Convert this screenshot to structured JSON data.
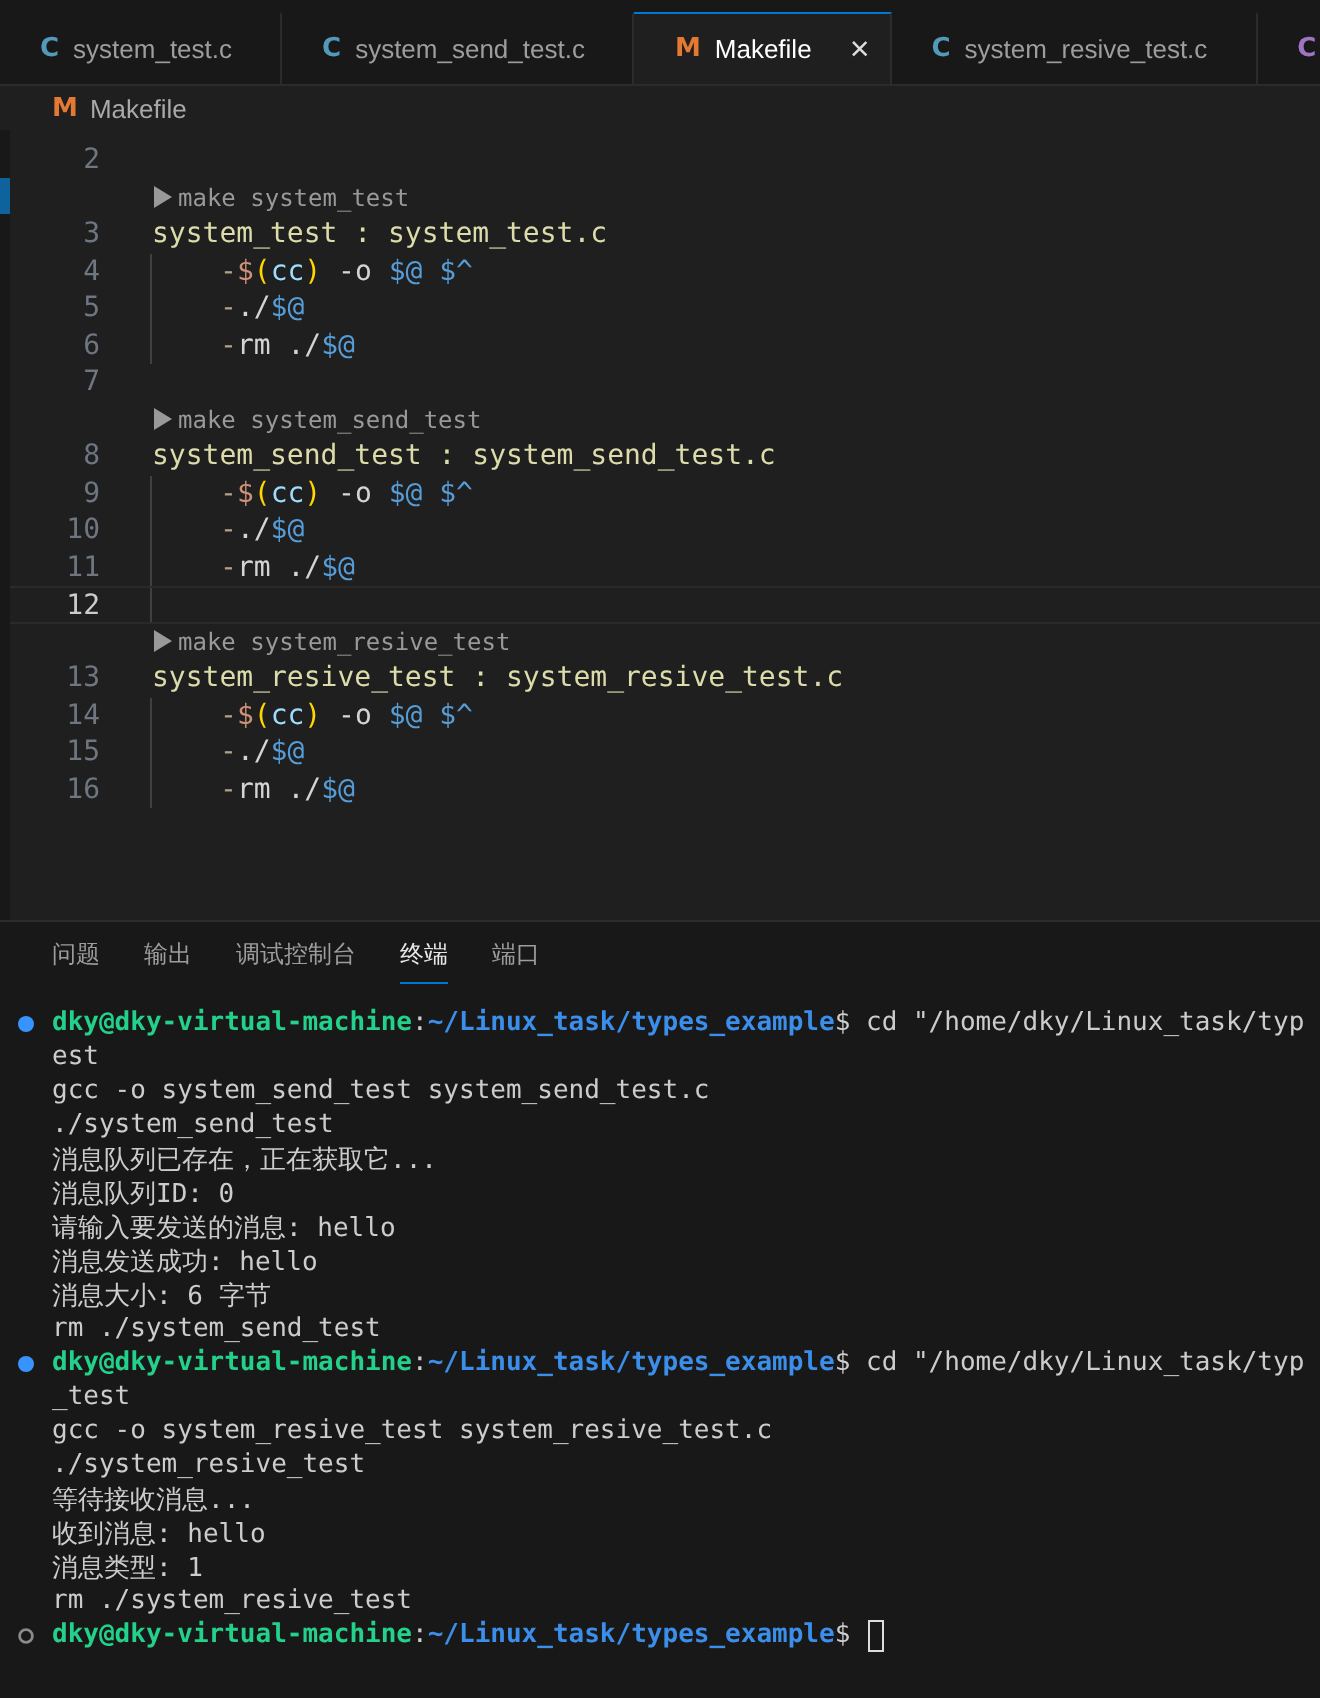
{
  "tabs": [
    {
      "icon": "C",
      "kind": "c",
      "label": "system_test.c",
      "selected": false
    },
    {
      "icon": "C",
      "kind": "c",
      "label": "system_send_test.c",
      "selected": false
    },
    {
      "icon": "M",
      "kind": "makefile",
      "label": "Makefile",
      "selected": true,
      "close": "×"
    },
    {
      "icon": "C",
      "kind": "c",
      "label": "system_resive_test.c",
      "selected": false
    },
    {
      "icon": "C",
      "kind": "other",
      "selected": false
    }
  ],
  "breadcrumb": {
    "icon": "M",
    "kind": "makefile",
    "label": "Makefile"
  },
  "editor_lines": [
    {
      "kind": "code",
      "number": "2",
      "current": false
    },
    {
      "kind": "codelens",
      "text": "make system_test"
    },
    {
      "kind": "code",
      "number": "3",
      "current": false,
      "segments": [
        {
          "text": "system_test : system_test.c",
          "kind": "target"
        }
      ]
    },
    {
      "kind": "code",
      "number": "4",
      "current": false,
      "indent": true,
      "segments": [
        {
          "text": "-",
          "kind": "dash"
        },
        {
          "text": "$",
          "kind": "dollar"
        },
        {
          "text": "(",
          "kind": "paren"
        },
        {
          "text": "cc",
          "kind": "var"
        },
        {
          "text": ")",
          "kind": "paren"
        },
        {
          "text": " -o ",
          "kind": "plain"
        },
        {
          "text": "$@ $^",
          "kind": "auto"
        }
      ]
    },
    {
      "kind": "code",
      "number": "5",
      "current": false,
      "indent": true,
      "segments": [
        {
          "text": "-",
          "kind": "dash"
        },
        {
          "text": "./",
          "kind": "plain"
        },
        {
          "text": "$@",
          "kind": "auto"
        }
      ]
    },
    {
      "kind": "code",
      "number": "6",
      "current": false,
      "indent": true,
      "segments": [
        {
          "text": "-",
          "kind": "dash"
        },
        {
          "text": "rm ./",
          "kind": "plain"
        },
        {
          "text": "$@",
          "kind": "auto"
        }
      ]
    },
    {
      "kind": "code",
      "number": "7",
      "current": false
    },
    {
      "kind": "codelens",
      "text": "make system_send_test"
    },
    {
      "kind": "code",
      "number": "8",
      "current": false,
      "segments": [
        {
          "text": "system_send_test : system_send_test.c",
          "kind": "target"
        }
      ]
    },
    {
      "kind": "code",
      "number": "9",
      "current": false,
      "indent": true,
      "segments": [
        {
          "text": "-",
          "kind": "dash"
        },
        {
          "text": "$",
          "kind": "dollar"
        },
        {
          "text": "(",
          "kind": "paren"
        },
        {
          "text": "cc",
          "kind": "var"
        },
        {
          "text": ")",
          "kind": "paren"
        },
        {
          "text": " -o ",
          "kind": "plain"
        },
        {
          "text": "$@ $^",
          "kind": "auto"
        }
      ]
    },
    {
      "kind": "code",
      "number": "10",
      "current": false,
      "indent": true,
      "segments": [
        {
          "text": "-",
          "kind": "dash"
        },
        {
          "text": "./",
          "kind": "plain"
        },
        {
          "text": "$@",
          "kind": "auto"
        }
      ]
    },
    {
      "kind": "code",
      "number": "11",
      "current": false,
      "indent": true,
      "segments": [
        {
          "text": "-",
          "kind": "dash"
        },
        {
          "text": "rm ./",
          "kind": "plain"
        },
        {
          "text": "$@",
          "kind": "auto"
        }
      ]
    },
    {
      "kind": "code",
      "number": "12",
      "current": true
    },
    {
      "kind": "codelens",
      "text": "make system_resive_test"
    },
    {
      "kind": "code",
      "number": "13",
      "current": false,
      "segments": [
        {
          "text": "system_resive_test : system_resive_test.c",
          "kind": "target"
        }
      ]
    },
    {
      "kind": "code",
      "number": "14",
      "current": false,
      "indent": true,
      "segments": [
        {
          "text": "-",
          "kind": "dash"
        },
        {
          "text": "$",
          "kind": "dollar"
        },
        {
          "text": "(",
          "kind": "paren"
        },
        {
          "text": "cc",
          "kind": "var"
        },
        {
          "text": ")",
          "kind": "paren"
        },
        {
          "text": " -o ",
          "kind": "plain"
        },
        {
          "text": "$@ $^",
          "kind": "auto"
        }
      ]
    },
    {
      "kind": "code",
      "number": "15",
      "current": false,
      "indent": true,
      "segments": [
        {
          "text": "-",
          "kind": "dash"
        },
        {
          "text": "./",
          "kind": "plain"
        },
        {
          "text": "$@",
          "kind": "auto"
        }
      ]
    },
    {
      "kind": "code",
      "number": "16",
      "current": false,
      "indent": true,
      "segments": [
        {
          "text": "-",
          "kind": "dash"
        },
        {
          "text": "rm ./",
          "kind": "plain"
        },
        {
          "text": "$@",
          "kind": "auto"
        }
      ]
    }
  ],
  "panel_tabs": [
    {
      "label": "问题",
      "selected": false
    },
    {
      "label": "输出",
      "selected": false
    },
    {
      "label": "调试控制台",
      "selected": false
    },
    {
      "label": "终端",
      "selected": true
    },
    {
      "label": "端口",
      "selected": false
    }
  ],
  "terminal": [
    {
      "kind": "prompt",
      "finished": true,
      "user": "dky@dky-virtual-machine",
      "sep": ":",
      "path": "~/Linux_task/types_example",
      "command": "$ cd \"/home/dky/Linux_task/typ",
      "cursor": false
    },
    {
      "kind": "output",
      "text": "est"
    },
    {
      "kind": "output",
      "text": "gcc -o system_send_test system_send_test.c"
    },
    {
      "kind": "output",
      "text": "./system_send_test"
    },
    {
      "kind": "output",
      "text": "消息队列已存在，正在获取它..."
    },
    {
      "kind": "output",
      "text": "消息队列ID: 0"
    },
    {
      "kind": "output",
      "text": "请输入要发送的消息: hello"
    },
    {
      "kind": "output",
      "text": "消息发送成功: hello"
    },
    {
      "kind": "output",
      "text": "消息大小: 6 字节"
    },
    {
      "kind": "output",
      "text": "rm ./system_send_test"
    },
    {
      "kind": "prompt",
      "finished": true,
      "user": "dky@dky-virtual-machine",
      "sep": ":",
      "path": "~/Linux_task/types_example",
      "command": "$ cd \"/home/dky/Linux_task/typ",
      "cursor": false
    },
    {
      "kind": "output",
      "text": "_test"
    },
    {
      "kind": "output",
      "text": "gcc -o system_resive_test system_resive_test.c"
    },
    {
      "kind": "output",
      "text": "./system_resive_test"
    },
    {
      "kind": "output",
      "text": "等待接收消息..."
    },
    {
      "kind": "output",
      "text": "收到消息: hello"
    },
    {
      "kind": "output",
      "text": "消息类型: 1"
    },
    {
      "kind": "output",
      "text": "rm ./system_resive_test"
    },
    {
      "kind": "prompt",
      "finished": false,
      "user": "dky@dky-virtual-machine",
      "sep": ":",
      "path": "~/Linux_task/types_example",
      "command": "$",
      "cursor": true
    }
  ]
}
